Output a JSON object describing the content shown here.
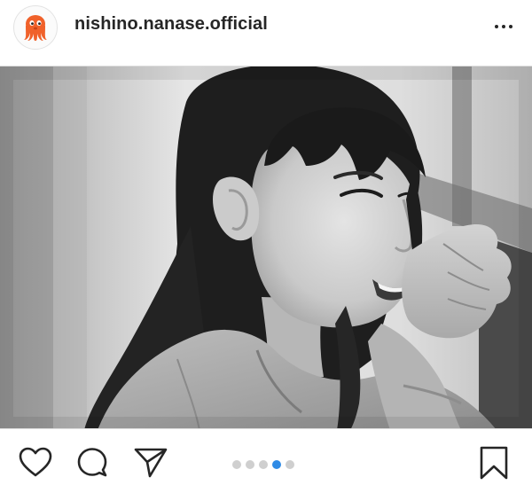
{
  "post": {
    "username": "nishino.nanase.official",
    "avatar_icon": "orange-octopus-icon",
    "more_icon": "more-options-icon"
  },
  "carousel": {
    "total": 5,
    "active_index": 3,
    "active_color": "#2f8be6",
    "inactive_color": "#cfcfcf"
  },
  "actions": {
    "like_icon": "heart-icon",
    "comment_icon": "comment-icon",
    "share_icon": "paper-plane-icon",
    "save_icon": "bookmark-icon"
  },
  "colors": {
    "avatar_octopus": "#f0612a",
    "text": "#262626"
  }
}
